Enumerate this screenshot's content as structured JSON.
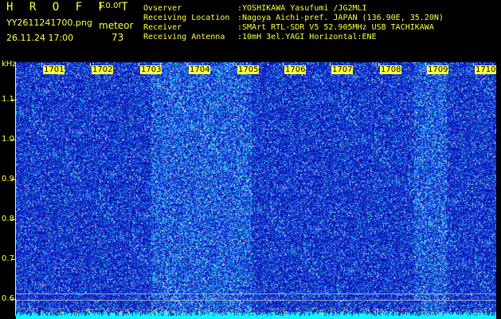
{
  "header": {
    "app_title": "H R O F F T",
    "app_version": "1.0.0f",
    "file_name": "YY2611241700.png",
    "date_time": "26.11.24 17:00",
    "mode_label": "meteor",
    "count_value": "73"
  },
  "info": [
    {
      "key": "Ovserver",
      "value": ":YOSHIKAWA Yasufumi /JG2MLI"
    },
    {
      "key": "Receiving Location",
      "value": ":Nagoya Aichi-pref. JAPAN (136.90E, 35.20N)"
    },
    {
      "key": "Receiver",
      "value": ":SMArt RTL-SDR V5 52.905MHz USB TACHIKAWA"
    },
    {
      "key": "Receiving Antenna",
      "value": ":10mH 3el.YAGI Horizontal:ENE"
    }
  ],
  "spectrogram": {
    "y_unit": "kHz",
    "y_ticks": [
      "1.1",
      "1.0",
      "0.9",
      "0.8",
      "0.7",
      "0.6"
    ],
    "x_ticks": [
      "1701",
      "1702",
      "1703",
      "1704",
      "1705",
      "1706",
      "1707",
      "1708",
      "1709",
      "1710"
    ],
    "colors": {
      "background": "#0000aa",
      "noise_low": "#1020c0",
      "noise_mid": "#2a6cff",
      "noise_high": "#20e0e0",
      "spark": "#ffffff",
      "axis": "#ffff40",
      "baseline": "#00ffff"
    }
  }
}
